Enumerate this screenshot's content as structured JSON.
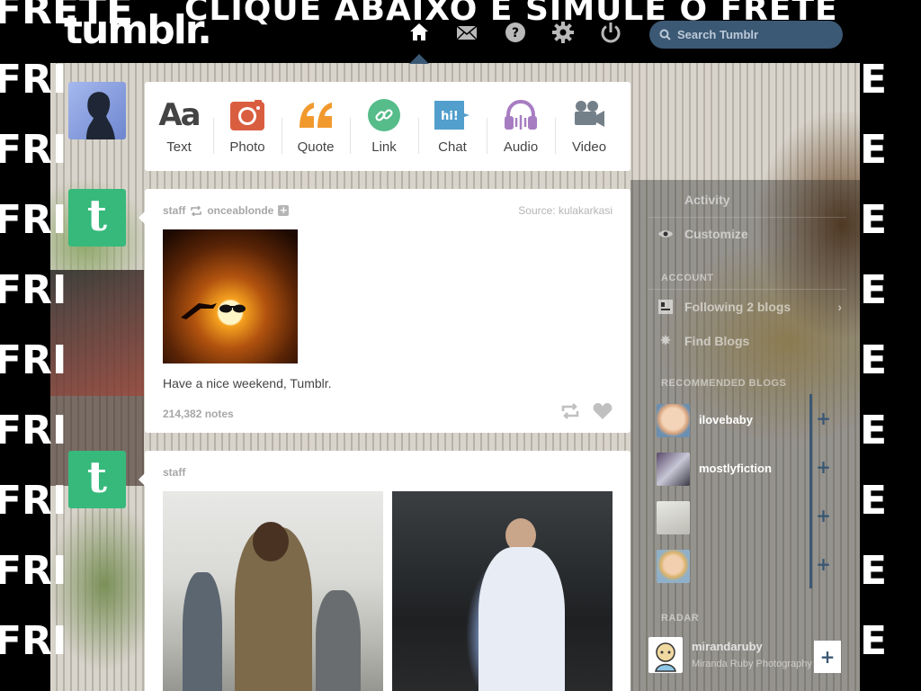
{
  "background": {
    "banner": "CLIQUE ABAIXO E SIMULE O FRETE",
    "left_word": "FRETE",
    "left_repeat": "FRI",
    "right_repeat": "E"
  },
  "header": {
    "logo": "tumblr.",
    "search_placeholder": "Search Tumblr",
    "nav_icons": [
      "home-icon",
      "envelope-icon",
      "help-icon",
      "gear-icon",
      "power-icon"
    ]
  },
  "post_types": [
    {
      "label": "Text",
      "icon": "text-icon",
      "color": "#444444"
    },
    {
      "label": "Photo",
      "icon": "camera-icon",
      "color": "#d95e40"
    },
    {
      "label": "Quote",
      "icon": "quote-icon",
      "color": "#f2992e"
    },
    {
      "label": "Link",
      "icon": "link-icon",
      "color": "#56bc8a"
    },
    {
      "label": "Chat",
      "icon": "chat-icon",
      "color": "#529ecc"
    },
    {
      "label": "Audio",
      "icon": "headphones-icon",
      "color": "#a77dc2"
    },
    {
      "label": "Video",
      "icon": "video-camera-icon",
      "color": "#748089"
    }
  ],
  "posts": [
    {
      "author": "staff",
      "reblogged_from": "onceablonde",
      "source": "Source: kulakarkasi",
      "caption": "Have a nice weekend, Tumblr.",
      "notes": "214,382 notes"
    },
    {
      "author": "staff"
    }
  ],
  "sidebar": {
    "links_top": [
      "Activity",
      "Customize"
    ],
    "account_header": "ACCOUNT",
    "following": "Following 2 blogs",
    "find_blogs": "Find Blogs",
    "recommended_header": "RECOMMENDED BLOGS",
    "recommended": [
      {
        "name": "ilovebaby"
      },
      {
        "name": "mostlyfiction"
      },
      {
        "name": ""
      },
      {
        "name": ""
      }
    ],
    "radar_header": "RADAR",
    "radar_name": "mirandaruby",
    "radar_sub": "Miranda Ruby Photography"
  },
  "colors": {
    "accent": "#3b5874",
    "tumblr_green": "#36b97b"
  }
}
